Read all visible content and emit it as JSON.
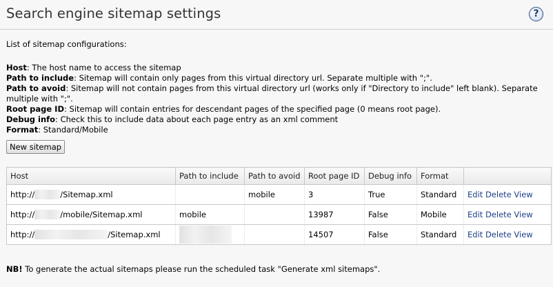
{
  "page": {
    "title": "Search engine sitemap settings",
    "help_label": "?",
    "intro": "List of sitemap configurations:",
    "descriptions": [
      {
        "term": "Host",
        "text": ": The host name to access the sitemap"
      },
      {
        "term": "Path to include",
        "text": ": Sitemap will contain only pages from this virtual directory url. Separate multiple with \";\"."
      },
      {
        "term": "Path to avoid",
        "text": ": Sitemap will not contain pages from this virtual directory url (works only if \"Directory to include\" left blank). Separate multiple with \";\"."
      },
      {
        "term": "Root page ID",
        "text": ": Sitemap will contain entries for descendant pages of the specified page (0 means root page)."
      },
      {
        "term": "Debug info",
        "text": ": Check this to include data about each page entry as an xml comment"
      },
      {
        "term": "Format",
        "text": ": Standard/Mobile"
      }
    ],
    "new_button": "New sitemap",
    "note_bold": "NB!",
    "note_text": " To generate the actual sitemaps please run the scheduled task \"Generate xml sitemaps\"."
  },
  "table": {
    "headers": [
      "Host",
      "Path to include",
      "Path to avoid",
      "Root page ID",
      "Debug info",
      "Format",
      ""
    ],
    "rows": [
      {
        "host_prefix": "http://",
        "host_suffix": "/Sitemap.xml",
        "include": "",
        "avoid": "mobile",
        "root": "3",
        "debug": "True",
        "format": "Standard"
      },
      {
        "host_prefix": "http://",
        "host_suffix": "/mobile/Sitemap.xml",
        "include": "mobile",
        "avoid": "",
        "root": "13987",
        "debug": "False",
        "format": "Mobile"
      },
      {
        "host_prefix": "http://",
        "host_suffix": "/Sitemap.xml",
        "include": "",
        "avoid": "",
        "root": "14507",
        "debug": "False",
        "format": "Standard"
      }
    ],
    "actions": {
      "edit": "Edit",
      "delete": "Delete",
      "view": "View"
    }
  }
}
